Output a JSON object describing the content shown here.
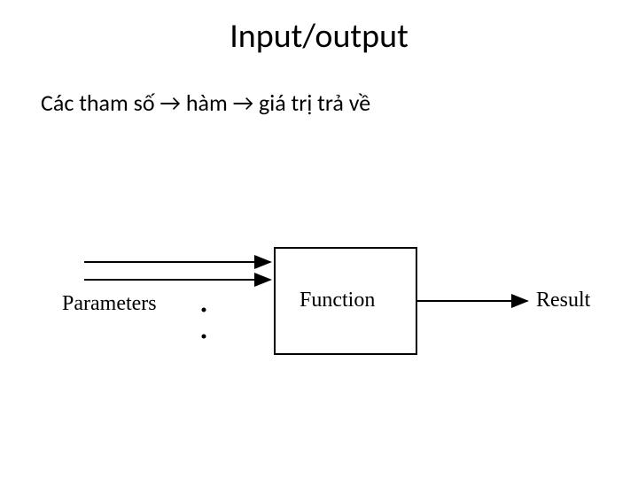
{
  "title": "Input/output",
  "subtitle": "Các tham số → hàm → giá trị trả về",
  "diagram": {
    "parameters_label": "Parameters",
    "function_label": "Function",
    "result_label": "Result"
  }
}
